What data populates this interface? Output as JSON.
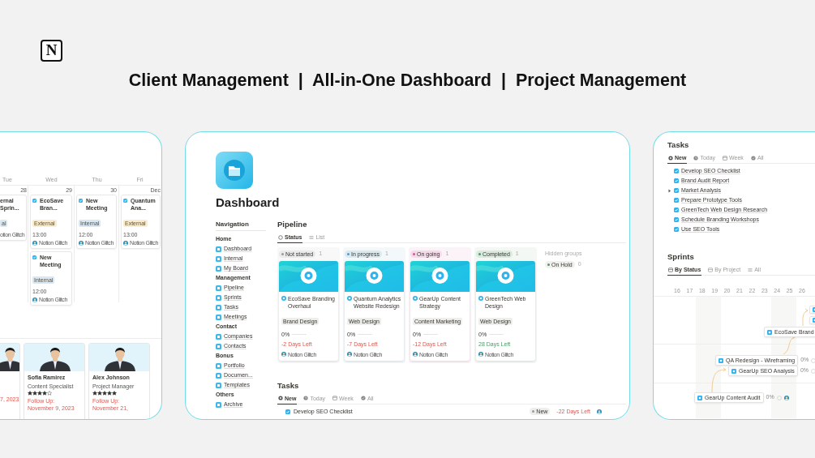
{
  "logo": {
    "glyph": "N"
  },
  "headline": "Client Management  |  All-in-One Dashboard  |  Project Management",
  "calendar_panel": {
    "days": [
      {
        "name": "Tue",
        "date": "28",
        "events": [
          {
            "title": "ernal Sprin...",
            "tag": "al",
            "color": "#d8e7f4",
            "owner": "otion Glitch"
          }
        ]
      },
      {
        "name": "Wed",
        "date": "29",
        "events": [
          {
            "title": "EcoSave Bran...",
            "tag": "External",
            "color": "#fbeccb",
            "time": "13:00",
            "owner": "Notion Glitch"
          },
          {
            "title": "New Meeting",
            "tag": "Internal",
            "color": "#d8e7f4",
            "time": "12:00",
            "owner": "Notion Glitch"
          }
        ]
      },
      {
        "name": "Thu",
        "date": "30",
        "events": [
          {
            "title": "New Meeting",
            "tag": "Internal",
            "color": "#d8e7f4",
            "time": "12:00",
            "owner": "Notion Glitch"
          }
        ]
      },
      {
        "name": "Fri",
        "date": "Dec",
        "events": [
          {
            "title": "Quantum Ana...",
            "tag": "External",
            "color": "#fbeccb",
            "time": "13:00",
            "owner": "Notion Glitch"
          }
        ]
      }
    ],
    "people": [
      {
        "follow_up": "7, 2023"
      },
      {
        "name": "Sofia Ramirez",
        "role": "Content Specialist",
        "stars": 4,
        "follow_up": "Follow Up: November 9, 2023"
      },
      {
        "name": "Alex Johnson",
        "role": "Project Manager",
        "stars": 5,
        "follow_up": "Follow Up: November 21,"
      }
    ]
  },
  "dashboard_panel": {
    "title": "Dashboard",
    "navigation": {
      "heading": "Navigation",
      "sections": [
        {
          "heading": "Home",
          "items": [
            "Dashboard",
            "Internal",
            "My Board"
          ]
        },
        {
          "heading": "Management",
          "items": [
            "Pipeline",
            "Sprints",
            "Tasks",
            "Meetings"
          ]
        },
        {
          "heading": "Contact",
          "items": [
            "Companies",
            "Contacts"
          ]
        },
        {
          "heading": "Bonus",
          "items": [
            "Portfolio",
            "Documen...",
            "Templates"
          ]
        },
        {
          "heading": "Others",
          "items": [
            "Archive"
          ]
        }
      ]
    },
    "pipeline": {
      "title": "Pipeline",
      "views": [
        {
          "label": "Status",
          "selected": true
        },
        {
          "label": "List",
          "selected": false
        }
      ],
      "groups": [
        {
          "status": "Not started",
          "color": "#9b9a97",
          "count": "1",
          "cards": [
            {
              "title": "EcoSave Branding Overhaul",
              "tag": "Brand Design",
              "progress": "0%",
              "level": 0,
              "due": "-2 Days Left",
              "overdue": true,
              "owner": "Notion Glitch"
            }
          ]
        },
        {
          "status": "In progress",
          "color": "#5b97bd",
          "count": "1",
          "cards": [
            {
              "title": "Quantum Analytics Website Redesign",
              "tag": "Web Design",
              "progress": "0%",
              "level": 0,
              "due": "-7 Days Left",
              "overdue": true,
              "owner": "Notion Glitch"
            }
          ]
        },
        {
          "status": "On going",
          "color": "#d15796",
          "count": "1",
          "cards": [
            {
              "title": "GearUp Content Strategy",
              "tag": "Content Marketing",
              "progress": "0%",
              "level": 0,
              "due": "-12 Days Left",
              "overdue": true,
              "owner": "Notion Glitch"
            }
          ]
        },
        {
          "status": "Completed",
          "color": "#4f9768",
          "count": "1",
          "cards": [
            {
              "title": "GreenTech Web Design",
              "tag": "Web Design",
              "progress": "0%",
              "level": 0,
              "due": "28 Days Left",
              "overdue": false,
              "owner": "Notion Glitch"
            }
          ]
        }
      ],
      "hidden_groups": {
        "label": "Hidden groups",
        "groups": [
          {
            "status": "On Hold",
            "color": "#4f9768",
            "count": "0"
          }
        ]
      }
    },
    "tasks": {
      "title": "Tasks",
      "views": [
        {
          "label": "New",
          "selected": true
        },
        {
          "label": "Today",
          "selected": false
        },
        {
          "label": "Week",
          "selected": false
        },
        {
          "label": "All",
          "selected": false
        }
      ],
      "rows": [
        {
          "title": "Develop SEO Checklist",
          "status": "New",
          "due": "-22 Days Left"
        }
      ]
    }
  },
  "tasks_panel": {
    "tasks": {
      "title": "Tasks",
      "views": [
        {
          "label": "New",
          "selected": true
        },
        {
          "label": "Today",
          "selected": false
        },
        {
          "label": "Week",
          "selected": false
        },
        {
          "label": "All",
          "selected": false
        }
      ],
      "items": [
        {
          "title": "Develop SEO Checklist"
        },
        {
          "title": "Brand Audit Report"
        },
        {
          "title": "Market Analysis",
          "expanded": false
        },
        {
          "title": "Prepare Prototype Tools"
        },
        {
          "title": "GreenTech Web Design Research"
        },
        {
          "title": "Schedule Branding Workshops"
        },
        {
          "title": "Use SEO Tools"
        }
      ]
    },
    "sprints": {
      "title": "Sprints",
      "views": [
        {
          "label": "By Status",
          "selected": true
        },
        {
          "label": "By Project",
          "selected": false
        },
        {
          "label": "All",
          "selected": false
        }
      ],
      "days": [
        "16",
        "17",
        "18",
        "19",
        "20",
        "21",
        "22",
        "23",
        "24",
        "25",
        "26"
      ],
      "items": [
        {
          "title": "EcoSave Brand"
        },
        {
          "title": "QA Redesign - Wireframing",
          "progress": "0%"
        },
        {
          "title": "GearUp SEO Analysis",
          "progress": "0%"
        },
        {
          "title": "GearUp Content Audit",
          "progress": "0%",
          "assigned": true
        }
      ]
    }
  }
}
